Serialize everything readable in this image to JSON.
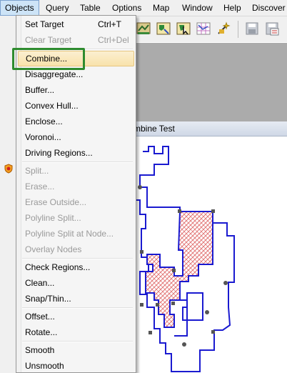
{
  "menubar": {
    "items": [
      {
        "label": "Objects",
        "active": true
      },
      {
        "label": "Query"
      },
      {
        "label": "Table"
      },
      {
        "label": "Options"
      },
      {
        "label": "Map"
      },
      {
        "label": "Window"
      },
      {
        "label": "Help"
      },
      {
        "label": "Discover"
      }
    ]
  },
  "document": {
    "title": "mbine Test"
  },
  "objects_menu": {
    "items": [
      {
        "label": "Set Target",
        "shortcut": "Ctrl+T",
        "enabled": true
      },
      {
        "label": "Clear Target",
        "shortcut": "Ctrl+Del",
        "enabled": false
      },
      {
        "label": "Combine...",
        "enabled": true,
        "highlighted": true
      },
      {
        "label": "Disaggregate...",
        "enabled": true
      },
      {
        "label": "Buffer...",
        "enabled": true
      },
      {
        "label": "Convex Hull...",
        "enabled": true
      },
      {
        "label": "Enclose...",
        "enabled": true
      },
      {
        "label": "Voronoi...",
        "enabled": true
      },
      {
        "label": "Driving Regions...",
        "enabled": true
      },
      {
        "label": "Split...",
        "enabled": false
      },
      {
        "label": "Erase...",
        "enabled": false
      },
      {
        "label": "Erase Outside...",
        "enabled": false
      },
      {
        "label": "Polyline Split...",
        "enabled": false
      },
      {
        "label": "Polyline Split at Node...",
        "enabled": false
      },
      {
        "label": "Overlay Nodes",
        "enabled": false
      },
      {
        "label": "Check Regions...",
        "enabled": true
      },
      {
        "label": "Clean...",
        "enabled": true
      },
      {
        "label": "Snap/Thin...",
        "enabled": true
      },
      {
        "label": "Offset...",
        "enabled": true
      },
      {
        "label": "Rotate...",
        "enabled": true
      },
      {
        "label": "Smooth",
        "enabled": true
      },
      {
        "label": "Unsmooth",
        "enabled": true
      }
    ]
  },
  "toolbar": {
    "icons": [
      "map-layer-icon",
      "map-edit-icon",
      "map-select-icon",
      "map-grid-icon",
      "map-wand-icon",
      "save-icon",
      "save-copy-icon"
    ]
  },
  "colors": {
    "accent_highlight": "#2e8b2e",
    "region_outline": "#1a1ad0",
    "region_hatch": "#e07070",
    "menu_hover": "#f8e2ab"
  }
}
